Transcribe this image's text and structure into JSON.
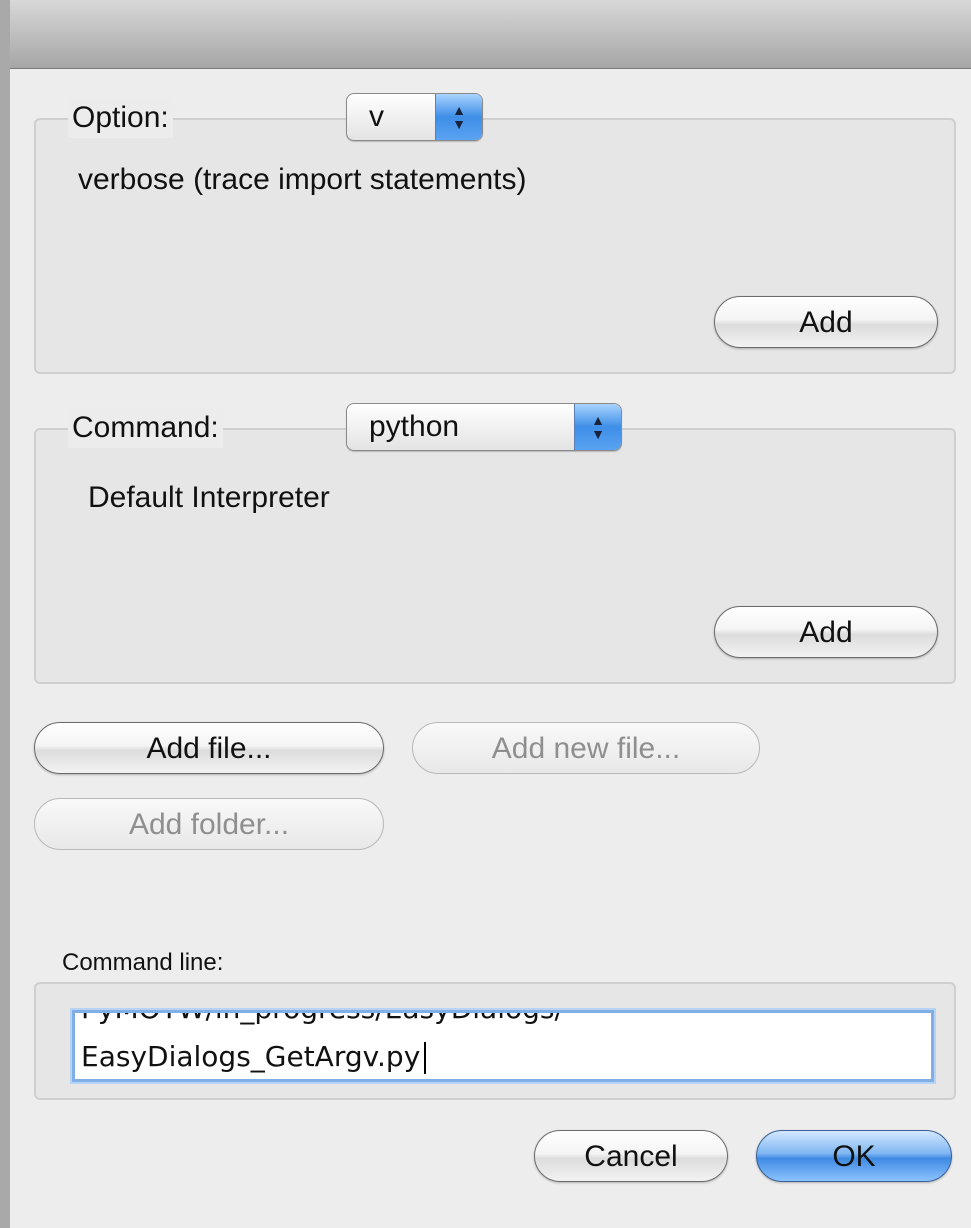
{
  "option_group": {
    "label": "Option:",
    "selected": "v",
    "description": "verbose (trace import statements)",
    "add_label": "Add"
  },
  "command_group": {
    "label": "Command:",
    "selected": "python",
    "description": "Default Interpreter",
    "add_label": "Add"
  },
  "file_buttons": {
    "add_file": "Add file...",
    "add_new_file": "Add new file...",
    "add_folder": "Add folder..."
  },
  "command_line": {
    "label": "Command line:",
    "line_partial": "PyMOTW/in_progress/EasyDialogs/",
    "line_visible": "EasyDialogs_GetArgv.py"
  },
  "footer": {
    "cancel": "Cancel",
    "ok": "OK"
  },
  "colors": {
    "accent_blue": "#3f8ae3",
    "focus_ring": "#80aee6",
    "window_bg": "#ededed"
  },
  "icons": {
    "popup_arrows": "up-down-arrows-icon"
  }
}
